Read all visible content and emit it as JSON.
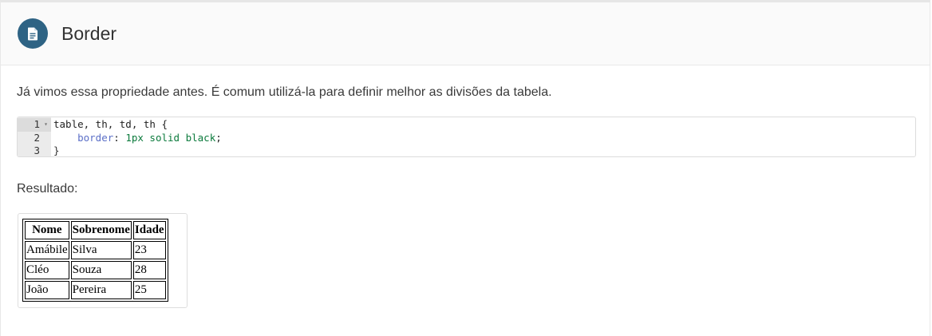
{
  "header": {
    "title": "Border",
    "icon": "document-icon",
    "icon_bg": "#2e6384"
  },
  "intro": "Já vimos essa propriedade antes. É comum utilizá-la para definir melhor as divisões da tabela.",
  "code": {
    "line_numbers": [
      "1",
      "2",
      "3"
    ],
    "line1": "table, th, td, th {",
    "line2_indent": "    ",
    "line2_prop": "border",
    "line2_colon": ": ",
    "line2_num": "1px",
    "line2_val": " solid black",
    "line2_semi": ";",
    "line3": "}"
  },
  "result_label": "Resultado:",
  "table": {
    "headers": [
      "Nome",
      "Sobrenome",
      "Idade"
    ],
    "rows": [
      [
        "Amábile",
        "Silva",
        "23"
      ],
      [
        "Cléo",
        "Souza",
        "28"
      ],
      [
        "João",
        "Pereira",
        "25"
      ]
    ]
  }
}
